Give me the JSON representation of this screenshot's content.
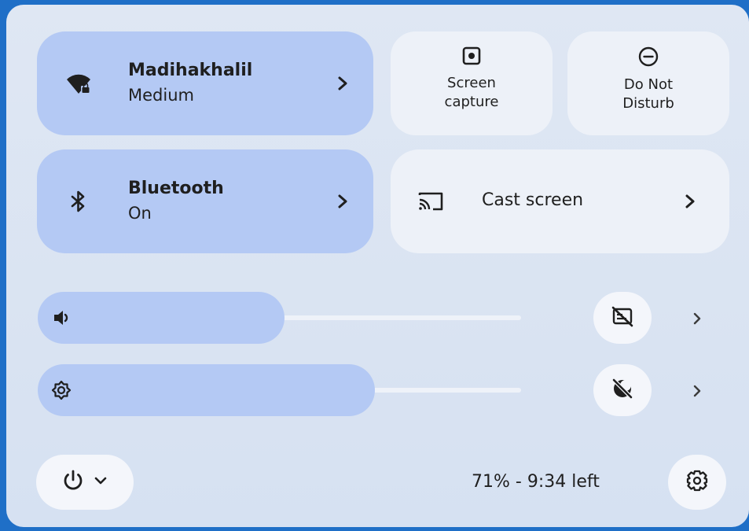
{
  "colors": {
    "active_tile": "#b4c9f4",
    "inactive_tile": "#edf1f8",
    "panel": "#dfe7f3",
    "icon": "#1f1f1f"
  },
  "network": {
    "title": "Madihakhalil",
    "status": "Medium",
    "icon": "wifi-locked-icon",
    "chevron": "chevron-right-icon"
  },
  "bluetooth": {
    "title": "Bluetooth",
    "status": "On",
    "icon": "bluetooth-icon",
    "chevron": "chevron-right-icon"
  },
  "screen_capture": {
    "label": "Screen\ncapture",
    "icon": "screen-capture-icon"
  },
  "do_not_disturb": {
    "label": "Do Not\nDisturb",
    "icon": "do-not-disturb-icon"
  },
  "cast": {
    "label": "Cast screen",
    "icon": "cast-icon",
    "chevron": "chevron-right-icon"
  },
  "volume": {
    "icon": "volume-icon",
    "level": 0.49,
    "side_button_icon": "captions-off-icon"
  },
  "brightness": {
    "icon": "brightness-icon",
    "level": 0.67,
    "side_button_icon": "night-light-off-icon"
  },
  "power": {
    "icon": "power-icon",
    "dropdown_icon": "chevron-down-icon"
  },
  "battery": {
    "text": "71% - 9:34 left"
  },
  "settings": {
    "icon": "gear-icon"
  }
}
